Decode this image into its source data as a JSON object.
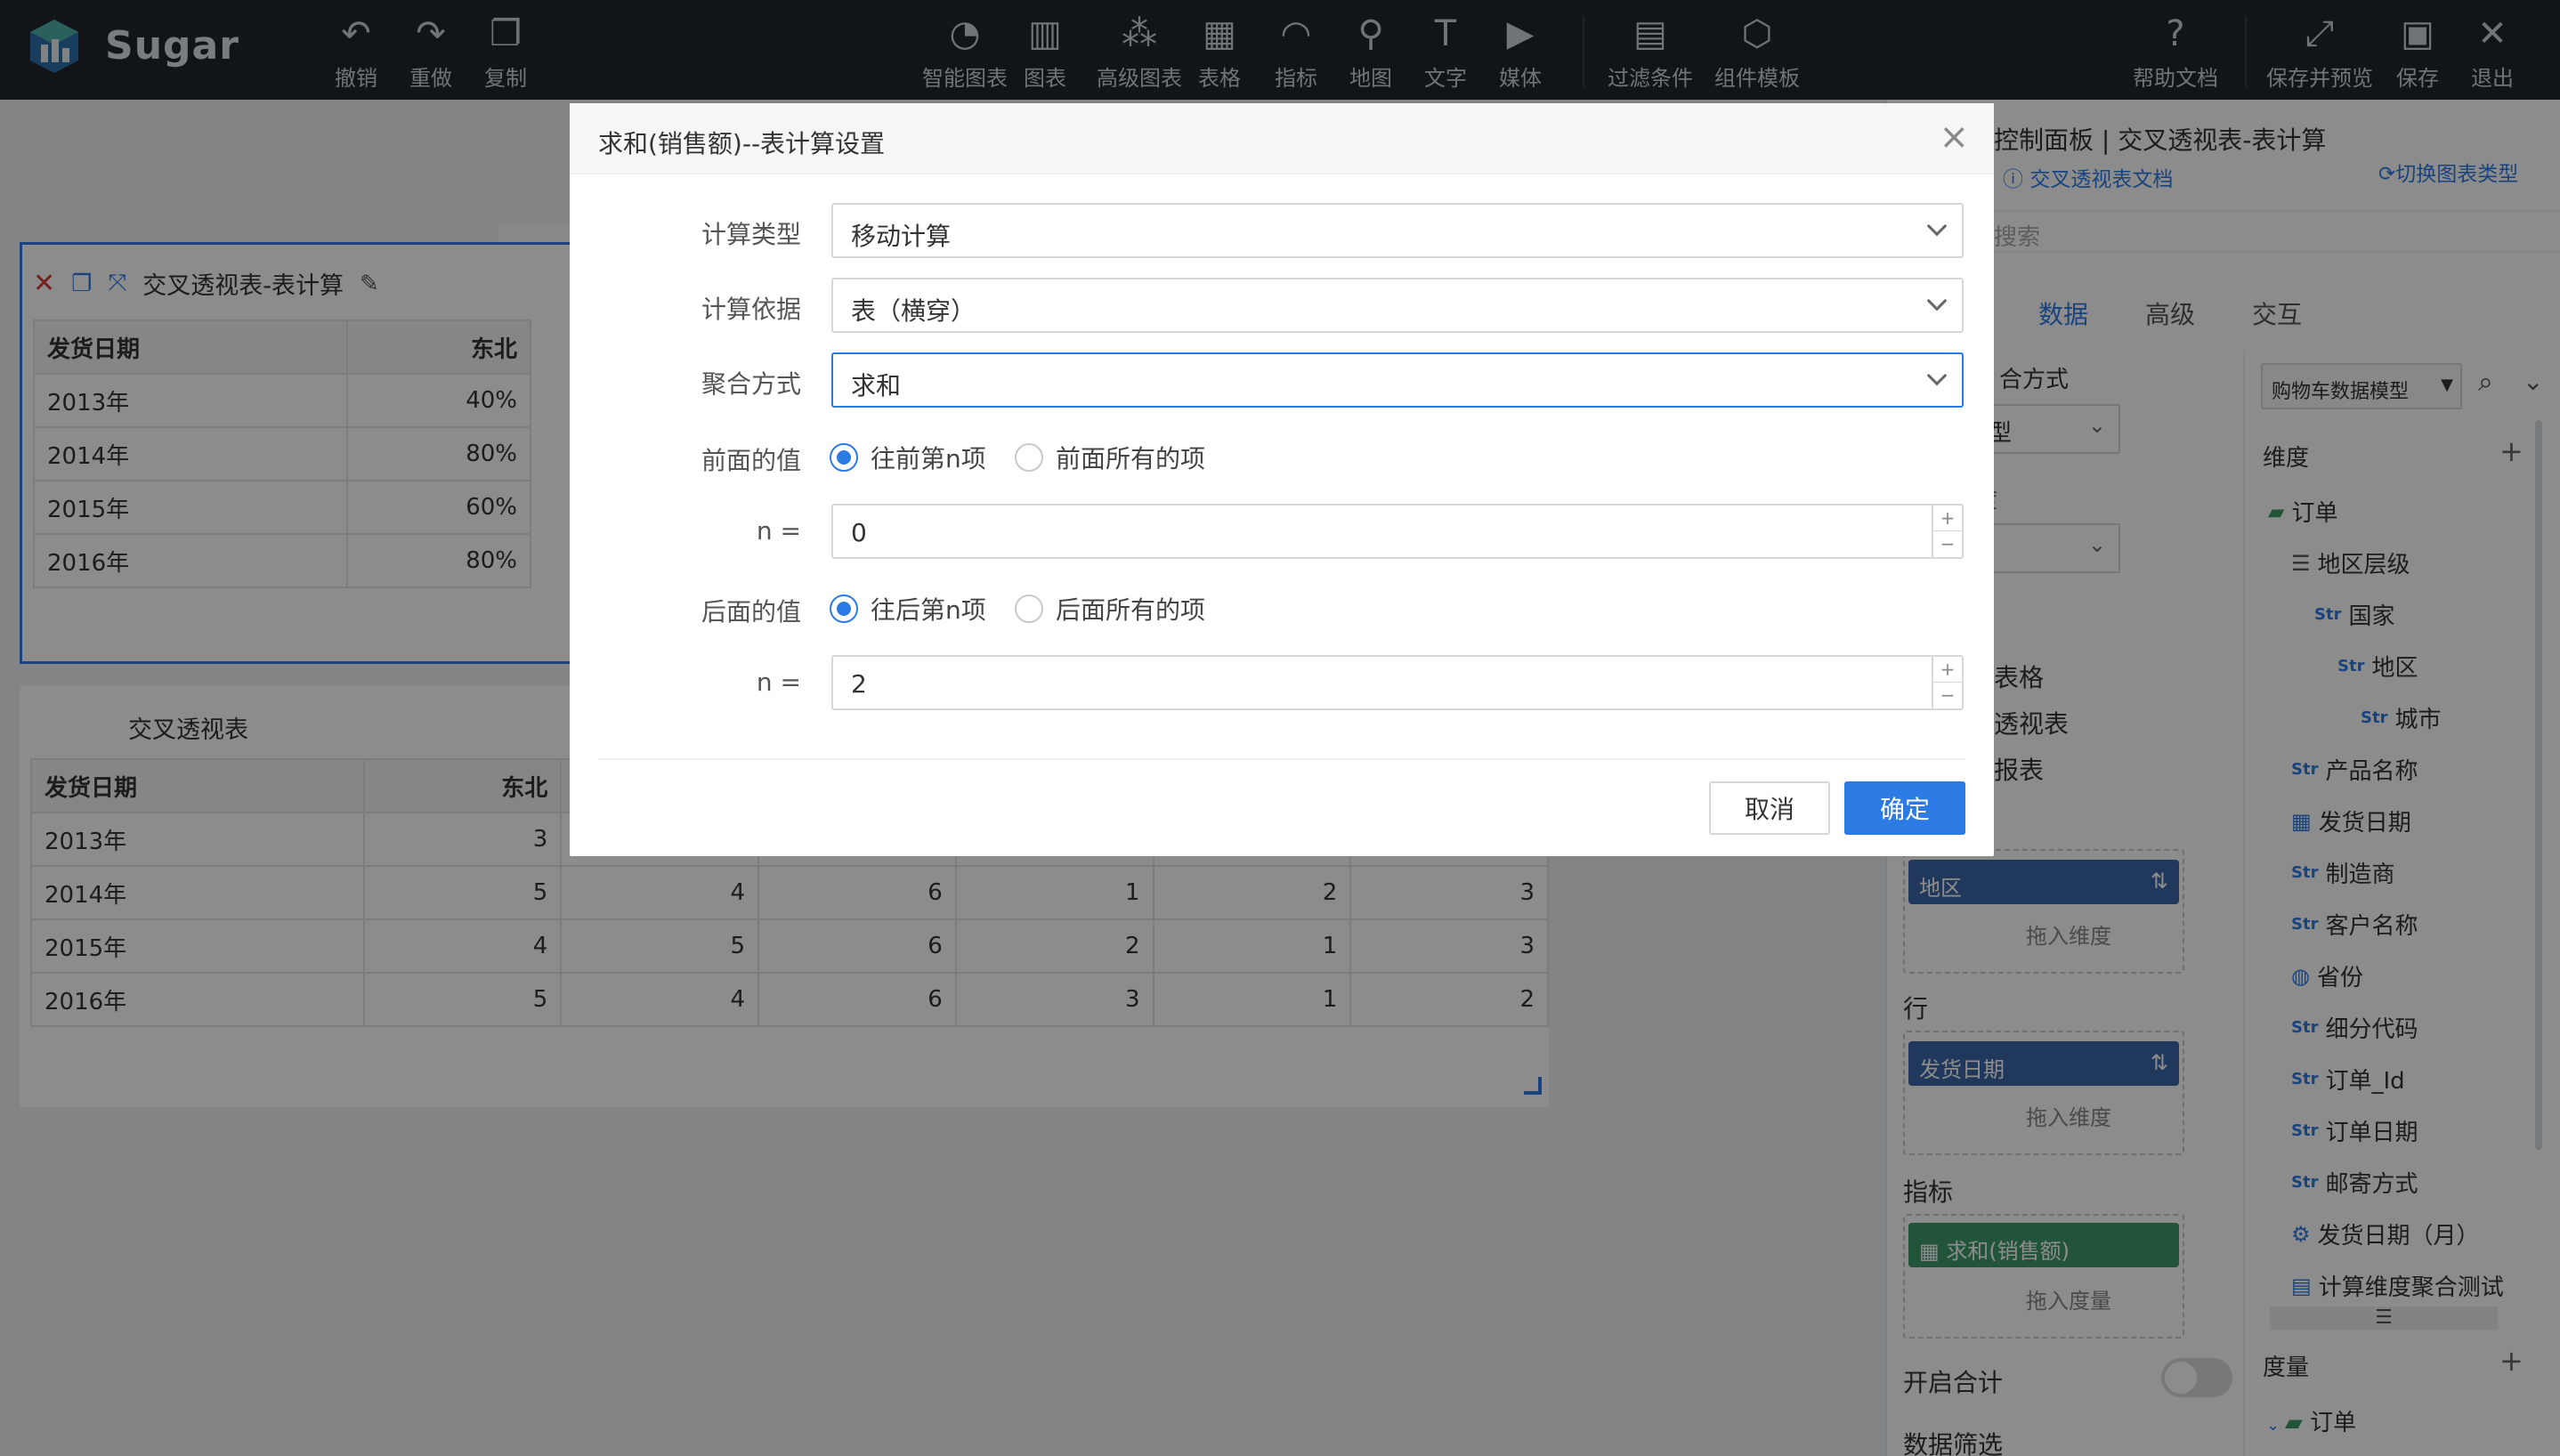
{
  "app": {
    "name": "Sugar"
  },
  "toolbar": {
    "left": [
      {
        "icon": "undo-icon",
        "glyph": "↶",
        "label": "撤销"
      },
      {
        "icon": "redo-icon",
        "glyph": "↷",
        "label": "重做"
      },
      {
        "icon": "copy-icon",
        "glyph": "❐",
        "label": "复制"
      }
    ],
    "center": [
      {
        "icon": "smart-chart-icon",
        "glyph": "◔",
        "label": "智能图表"
      },
      {
        "icon": "chart-icon",
        "glyph": "▥",
        "label": "图表"
      },
      {
        "icon": "advanced-chart-icon",
        "glyph": "⁂",
        "label": "高级图表"
      },
      {
        "icon": "table-icon",
        "glyph": "▦",
        "label": "表格"
      },
      {
        "icon": "gauge-icon",
        "glyph": "◠",
        "label": "指标"
      },
      {
        "icon": "map-icon",
        "glyph": "⚲",
        "label": "地图"
      },
      {
        "icon": "text-icon",
        "glyph": "T",
        "label": "文字"
      },
      {
        "icon": "media-icon",
        "glyph": "▶",
        "label": "媒体"
      }
    ],
    "center2": [
      {
        "icon": "filter-icon",
        "glyph": "▤",
        "label": "过滤条件"
      },
      {
        "icon": "template-icon",
        "glyph": "⬡",
        "label": "组件模板"
      }
    ],
    "right": [
      {
        "icon": "help-icon",
        "glyph": "?",
        "label": "帮助文档"
      },
      {
        "icon": "save-preview-icon",
        "glyph": "⤢",
        "label": "保存并预览"
      },
      {
        "icon": "save-icon",
        "glyph": "▣",
        "label": "保存"
      },
      {
        "icon": "exit-icon",
        "glyph": "✕",
        "label": "退出"
      }
    ]
  },
  "card1": {
    "title": "交叉透视表-表计算",
    "headers": [
      "发货日期",
      "东北"
    ],
    "rows": [
      [
        "2013年",
        "40%"
      ],
      [
        "2014年",
        "80%"
      ],
      [
        "2015年",
        "60%"
      ],
      [
        "2016年",
        "80%"
      ]
    ]
  },
  "card2": {
    "title": "交叉透视表",
    "headers": [
      "发货日期",
      "东北",
      "",
      "",
      "",
      "",
      ""
    ],
    "rows": [
      [
        "2013年",
        "3",
        "",
        "",
        "",
        "",
        ""
      ],
      [
        "2014年",
        "5",
        "4",
        "6",
        "1",
        "2",
        "3"
      ],
      [
        "2015年",
        "4",
        "5",
        "6",
        "2",
        "1",
        "3"
      ],
      [
        "2016年",
        "5",
        "4",
        "6",
        "3",
        "1",
        "2"
      ]
    ]
  },
  "panel": {
    "title": "控制面板 | 交叉透视表-表计算",
    "doc_link": "交叉透视表文档",
    "switch_type": "切换图表类型",
    "search_placeholder": "搜索",
    "tabs": [
      "数据",
      "高级",
      "交互"
    ],
    "agg_label": "合方式",
    "agg_value": "型",
    "field2_label": "度",
    "items_partial": [
      "表格",
      "透视表",
      "报表"
    ],
    "model_select": "购物车数据模型",
    "dimension_label": "维度",
    "measure_label": "度量",
    "columns_pill": "地区",
    "drop_dim": "拖入维度",
    "row_label": "行",
    "rows_pill": "发货日期",
    "metric_label": "指标",
    "metric_pill": "求和(销售额)",
    "drop_measure": "拖入度量",
    "total_label": "开启合计",
    "filter_label": "数据筛选",
    "tree": [
      {
        "type": "folder",
        "text": "订单",
        "indent": 0
      },
      {
        "type": "hier",
        "text": "地区层级",
        "indent": 1
      },
      {
        "type": "str",
        "text": "国家",
        "indent": 2
      },
      {
        "type": "str",
        "text": "地区",
        "indent": 3
      },
      {
        "type": "str",
        "text": "城市",
        "indent": 4
      },
      {
        "type": "str",
        "text": "产品名称",
        "indent": 1
      },
      {
        "type": "date",
        "text": "发货日期",
        "indent": 1
      },
      {
        "type": "str",
        "text": "制造商",
        "indent": 1
      },
      {
        "type": "str",
        "text": "客户名称",
        "indent": 1
      },
      {
        "type": "geo",
        "text": "省份",
        "indent": 1
      },
      {
        "type": "str",
        "text": "细分代码",
        "indent": 1
      },
      {
        "type": "str",
        "text": "订单_Id",
        "indent": 1
      },
      {
        "type": "str",
        "text": "订单日期",
        "indent": 1
      },
      {
        "type": "str",
        "text": "邮寄方式",
        "indent": 1
      },
      {
        "type": "calc",
        "text": "发货日期（月）",
        "indent": 1
      },
      {
        "type": "calc2",
        "text": "计算维度聚合测试",
        "indent": 1
      }
    ],
    "measure_tree_first": "订单"
  },
  "dialog": {
    "title": "求和(销售额)--表计算设置",
    "calc_type_label": "计算类型",
    "calc_type_value": "移动计算",
    "calc_basis_label": "计算依据",
    "calc_basis_value": "表（横穿）",
    "agg_label": "聚合方式",
    "agg_value": "求和",
    "prev_label": "前面的值",
    "prev_opt1": "往前第n项",
    "prev_opt2": "前面所有的项",
    "n_label": "n =",
    "prev_n": "0",
    "next_label": "后面的值",
    "next_opt1": "往后第n项",
    "next_opt2": "后面所有的项",
    "next_n": "2",
    "cancel": "取消",
    "ok": "确定"
  },
  "colors": {
    "accent": "#2c7be5",
    "topbar": "#20272f",
    "pill_blue": "#3a66a8",
    "pill_green": "#3f9a6b"
  }
}
